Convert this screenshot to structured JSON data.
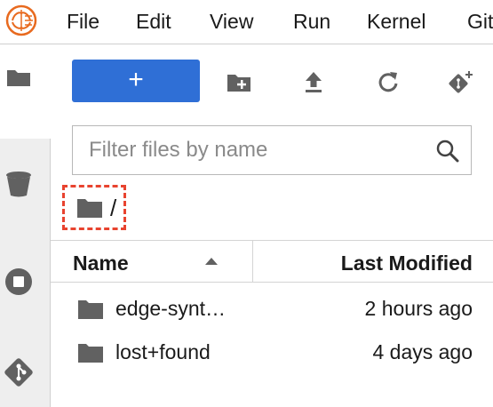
{
  "menubar": {
    "items": [
      "File",
      "Edit",
      "View",
      "Run",
      "Kernel",
      "Git"
    ]
  },
  "toolbar": {
    "new_label": "+",
    "icons": [
      "new-folder-icon",
      "upload-icon",
      "refresh-icon",
      "git-clone-icon"
    ]
  },
  "filter": {
    "placeholder": "Filter files by name",
    "value": ""
  },
  "breadcrumb": {
    "path": "/"
  },
  "listing": {
    "headers": {
      "name": "Name",
      "modified": "Last Modified"
    },
    "sort": "ascending",
    "rows": [
      {
        "name": "edge-synt…",
        "modified": "2 hours ago",
        "type": "folder"
      },
      {
        "name": "lost+found",
        "modified": "4 days ago",
        "type": "folder"
      }
    ]
  },
  "sidebar": {
    "icons": [
      "folder-icon",
      "trash-icon",
      "stop-circle-icon",
      "git-icon"
    ]
  },
  "colors": {
    "accent": "#2f6fd6",
    "highlight": "#e8432f",
    "rail": "#eeeeee"
  }
}
